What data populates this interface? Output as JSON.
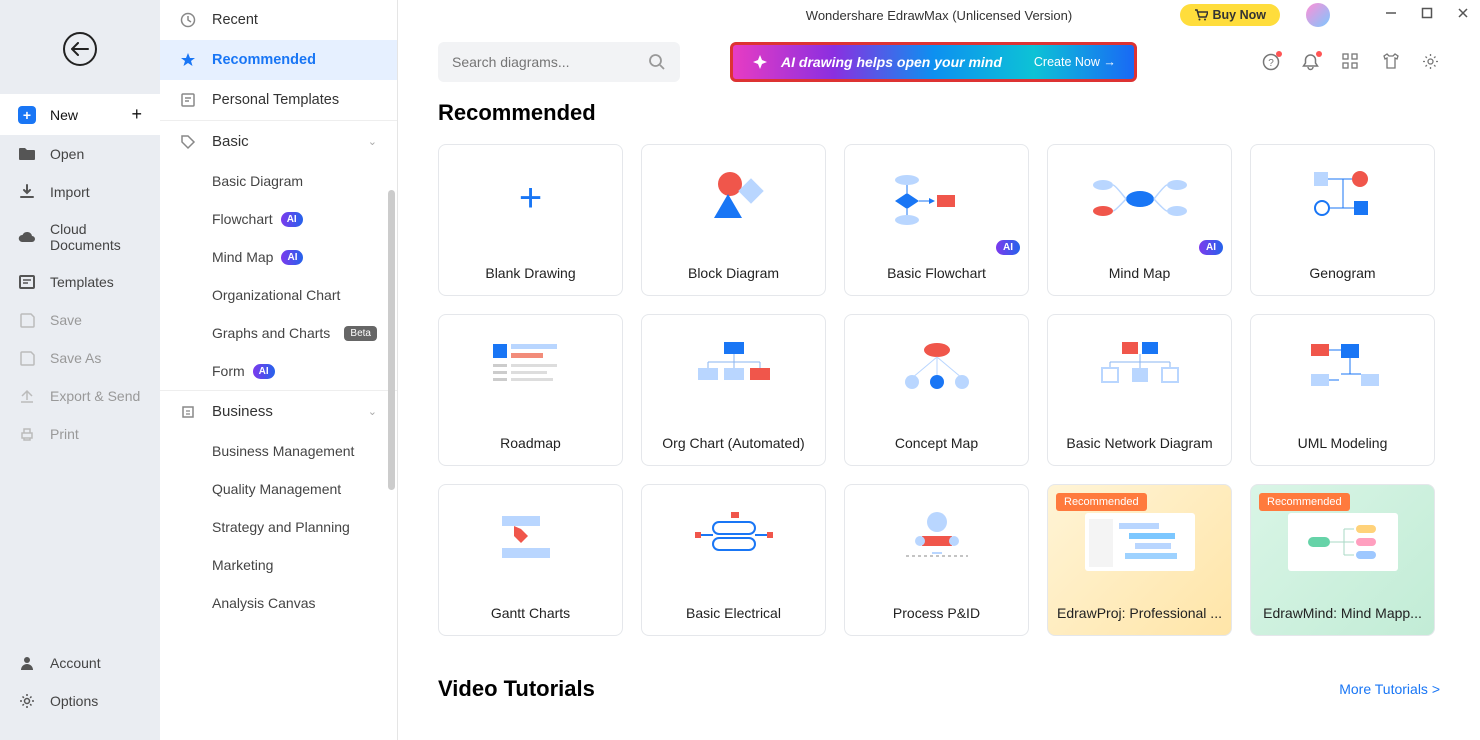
{
  "app_title": "Wondershare EdrawMax (Unlicensed Version)",
  "buy_now": "Buy Now",
  "nav": {
    "new": "New",
    "open": "Open",
    "import": "Import",
    "cloud": "Cloud Documents",
    "templates": "Templates",
    "save": "Save",
    "saveas": "Save As",
    "export": "Export & Send",
    "print": "Print",
    "account": "Account",
    "options": "Options"
  },
  "cat": {
    "recent": "Recent",
    "recommended": "Recommended",
    "personal": "Personal Templates",
    "basic": "Basic",
    "basic_diagram": "Basic Diagram",
    "flowchart": "Flowchart",
    "mindmap": "Mind Map",
    "org_chart": "Organizational Chart",
    "graphs": "Graphs and Charts",
    "form": "Form",
    "business": "Business",
    "bus_mgmt": "Business Management",
    "quality": "Quality Management",
    "strategy": "Strategy and Planning",
    "marketing": "Marketing",
    "analysis": "Analysis Canvas"
  },
  "search_placeholder": "Search diagrams...",
  "ai_banner_text": "AI drawing helps open your mind",
  "ai_banner_action": "Create Now →",
  "section_recommended": "Recommended",
  "cards": {
    "blank": "Blank Drawing",
    "block": "Block Diagram",
    "flow": "Basic Flowchart",
    "mind": "Mind Map",
    "geno": "Genogram",
    "roadmap": "Roadmap",
    "orgauto": "Org Chart (Automated)",
    "concept": "Concept Map",
    "network": "Basic Network Diagram",
    "uml": "UML Modeling",
    "gantt": "Gantt Charts",
    "elec": "Basic Electrical",
    "pid": "Process P&ID",
    "proj": "EdrawProj: Professional ...",
    "edmind": "EdrawMind: Mind Mapp..."
  },
  "ai_label": "AI",
  "beta_label": "Beta",
  "reco_label": "Recommended",
  "section_video": "Video Tutorials",
  "more_tutorials": "More Tutorials  >"
}
